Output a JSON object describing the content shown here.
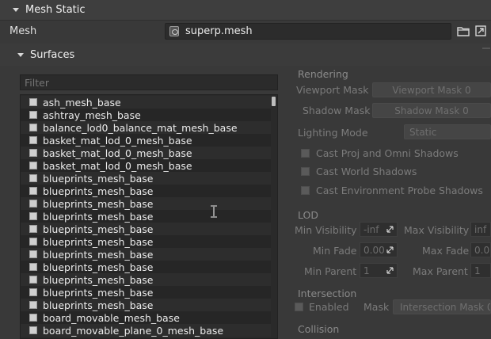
{
  "mesh_static": {
    "title": "Mesh Static"
  },
  "mesh": {
    "label": "Mesh",
    "value": "superp.mesh"
  },
  "surfaces": {
    "title": "Surfaces",
    "filter_placeholder": "Filter",
    "items": [
      "ash_mesh_base",
      "ashtray_mesh_base",
      "balance_lod0_balance_mat_mesh_base",
      "basket_mat_lod_0_mesh_base",
      "basket_mat_lod_0_mesh_base",
      "basket_mat_lod_0_mesh_base",
      "blueprints_mesh_base",
      "blueprints_mesh_base",
      "blueprints_mesh_base",
      "blueprints_mesh_base",
      "blueprints_mesh_base",
      "blueprints_mesh_base",
      "blueprints_mesh_base",
      "blueprints_mesh_base",
      "blueprints_mesh_base",
      "blueprints_mesh_base",
      "blueprints_mesh_base",
      "board_movable_mesh_base",
      "board_movable_plane_0_mesh_base"
    ]
  },
  "rendering": {
    "title": "Rendering",
    "viewport_mask_label": "Viewport Mask",
    "viewport_mask_value": "Viewport Mask 0",
    "shadow_mask_label": "Shadow Mask",
    "shadow_mask_value": "Shadow Mask 0",
    "lighting_mode_label": "Lighting Mode",
    "lighting_mode_value": "Static",
    "cast_proj_omni": "Cast Proj and Omni Shadows",
    "cast_world": "Cast World Shadows",
    "cast_env_probe": "Cast Environment Probe Shadows"
  },
  "lod": {
    "title": "LOD",
    "min_visibility_label": "Min Visibility",
    "min_visibility_value": "-inf",
    "max_visibility_label": "Max Visibility",
    "max_visibility_value": "inf",
    "min_fade_label": "Min Fade",
    "min_fade_value": "0.00",
    "max_fade_label": "Max Fade",
    "max_fade_value": "0.00",
    "min_parent_label": "Min Parent",
    "min_parent_value": "1",
    "max_parent_label": "Max Parent",
    "max_parent_value": "1"
  },
  "intersection": {
    "title": "Intersection",
    "enabled_label": "Enabled",
    "mask_label": "Mask",
    "mask_value": "Intersection Mask 0"
  },
  "collision": {
    "title": "Collision"
  },
  "icons": {
    "mesh_file": "mesh-file-icon",
    "open_folder": "folder-icon",
    "open_external": "open-external-icon",
    "collapse": "collapse-triangle-icon",
    "text_cursor": "text-cursor-icon"
  },
  "colors": {
    "background": "#393939",
    "panel": "#2a2a2a",
    "text": "#e6e6e6",
    "disabled_text": "#7b7b7b"
  }
}
